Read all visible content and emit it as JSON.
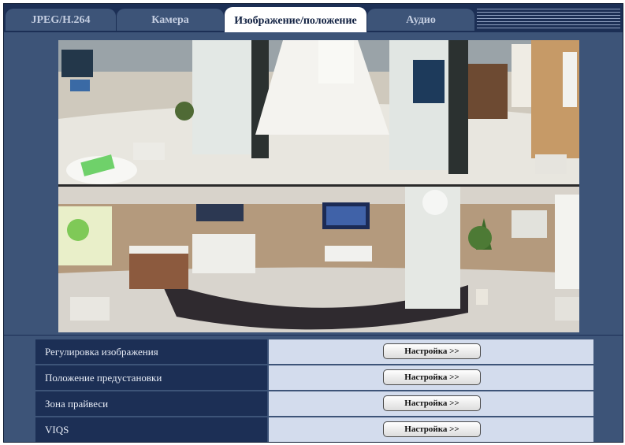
{
  "tabs": [
    {
      "label": "JPEG/H.264",
      "active": false
    },
    {
      "label": "Камера",
      "active": false
    },
    {
      "label": "Изображение/положение",
      "active": true
    },
    {
      "label": "Аудио",
      "active": false
    }
  ],
  "preview": {
    "type": "camera-panorama-dual-view"
  },
  "settings": [
    {
      "label": "Регулировка изображения",
      "button": "Настройка >>"
    },
    {
      "label": "Положение предустановки",
      "button": "Настройка >>"
    },
    {
      "label": "Зона прайвеси",
      "button": "Настройка >>"
    },
    {
      "label": "VIQS",
      "button": "Настройка >>"
    }
  ],
  "colors": {
    "navy": "#1c2f55",
    "panel": "#3d5478",
    "cell": "#d3dced"
  }
}
